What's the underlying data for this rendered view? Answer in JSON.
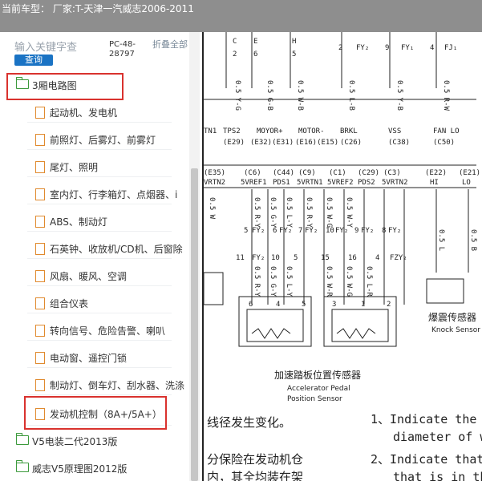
{
  "header": {
    "title": "当前车型： 厂家:T-天津一汽威志2006-2011"
  },
  "search": {
    "placeholder": "输入关键字查",
    "button_label": "查询"
  },
  "toolbar": {
    "pc_code": "PC-48-28797",
    "fold_all": "折叠全部"
  },
  "tree": {
    "root": {
      "label": "3厢电路图"
    },
    "children": [
      {
        "label": "起动机、发电机"
      },
      {
        "label": "前照灯、后雾灯、前雾灯"
      },
      {
        "label": "尾灯、照明"
      },
      {
        "label": "室内灯、行李箱灯、点烟器、i"
      },
      {
        "label": "ABS、制动灯"
      },
      {
        "label": "石英钟、收放机/CD机、后窗除"
      },
      {
        "label": "风扇、暖风、空调"
      },
      {
        "label": "组合仪表"
      },
      {
        "label": "转向信号、危险告警、喇叭"
      },
      {
        "label": "电动窗、遥控门锁"
      },
      {
        "label": "制动灯、倒车灯、刮水器、洗涤"
      },
      {
        "label": "发动机控制（8A+/5A+）"
      }
    ],
    "siblings": [
      {
        "label": "V5电装二代2013版"
      },
      {
        "label": "威志V5原理图2012版"
      }
    ]
  },
  "diagram": {
    "top_labels": [
      "C",
      "E",
      "H",
      "2",
      "6",
      "5"
    ],
    "fuse_top": [
      "FY₂",
      "FY₁",
      "FJ₁",
      "2",
      "9",
      "4"
    ],
    "wire_top": [
      "0.5 Y-G",
      "0.5 G-B",
      "0.5 W-B",
      "0.5 L-B",
      "0.5 Y-B",
      "0.5 R-W"
    ],
    "conn_row1": [
      "TN1",
      "TPS2",
      "MOYOR+",
      "MOTOR-",
      "BRKL",
      "VSS",
      "FAN LO"
    ],
    "conn_row2": [
      "(E29)",
      "(E32)(E31)",
      "(E16)(E15)",
      "(C26)",
      "(C38)",
      "(C50)"
    ],
    "pin_row1": [
      "(E35)",
      "(C6)",
      "(C44)",
      "(C9)",
      "(C1)",
      "(C29)",
      "(C3)",
      "(E22)",
      "(E21)"
    ],
    "pin_row2": [
      "VRTN2",
      "5VREF1",
      "PDS1",
      "5VRTN1",
      "5VREF2",
      "PDS2",
      "5VRTN2",
      "HI",
      "LO"
    ],
    "wire_mid": [
      "0.5 W",
      "0.5 R-Y",
      "0.5 G-Y",
      "0.5 L-Y",
      "0.5 R-Y",
      "0.5 W-G",
      "0.5 W-Y",
      "0.5 L",
      "0.5 B"
    ],
    "fy_upper": [
      "5",
      "FY₂",
      "6",
      "FY₂",
      "7",
      "FY₂",
      "10",
      "FY₂",
      "9",
      "FY₂",
      "8",
      "FY₂"
    ],
    "fy_lower": [
      "11",
      "FY₂",
      "10",
      "5",
      "15",
      "16",
      "4",
      "FZY₂"
    ],
    "wire_low": [
      "0.5 R-Y",
      "0.5 G-Y",
      "0.5 L-Y",
      "0.5 W-R",
      "0.5 W-G",
      "0.5 L-R"
    ],
    "sensor_pins": [
      "6",
      "4",
      "5",
      "3",
      "1",
      "2"
    ],
    "knock_cn": "爆震传感器",
    "knock_en": "Knock Sensor",
    "pedal_cn": "加速踏板位置传感器",
    "pedal_en1": "Accelerator Pedal",
    "pedal_en2": "Position Sensor",
    "note_cn1": "线径发生变化。",
    "note_cn2": "分保险在发动机仓",
    "note_cn3": "内，其全均装在架",
    "note_en1a": "1、Indicate the c",
    "note_en1b": "diameter of wi",
    "note_en2a": "2、Indicate that",
    "note_en2b": "that is in th"
  }
}
